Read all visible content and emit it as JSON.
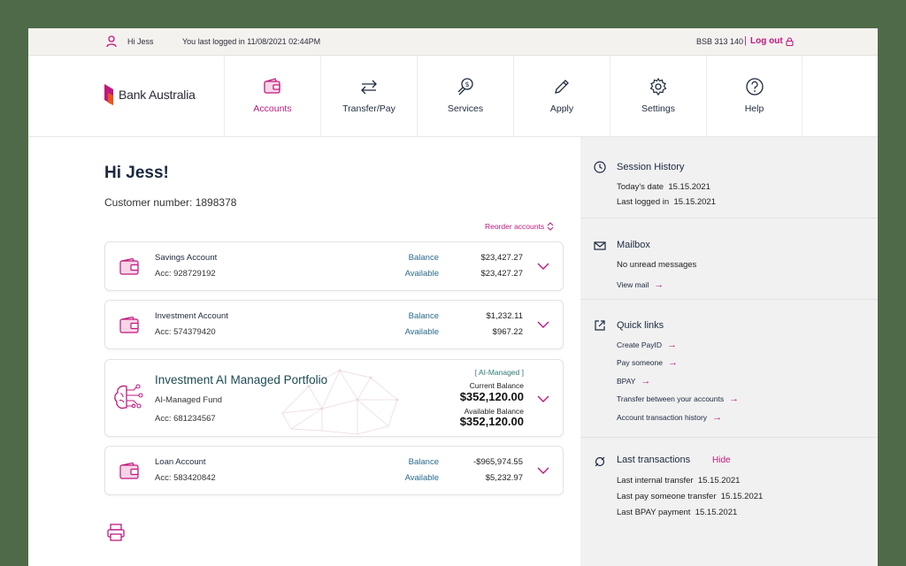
{
  "topbar": {
    "greeting": "Hi Jess",
    "last_login": "You last logged in 11/08/2021 02:44PM",
    "bsb": "BSB 313 140",
    "separator": "|",
    "logout": "Log out"
  },
  "brand": {
    "name": "Bank Australia",
    "accent": "#c0187d"
  },
  "nav": [
    {
      "label": "Accounts",
      "icon": "wallet-icon",
      "active": true
    },
    {
      "label": "Transfer/Pay",
      "icon": "transfer-icon"
    },
    {
      "label": "Services",
      "icon": "services-icon"
    },
    {
      "label": "Apply",
      "icon": "pencil-icon"
    },
    {
      "label": "Settings",
      "icon": "gear-icon"
    },
    {
      "label": "Help",
      "icon": "help-icon"
    }
  ],
  "main": {
    "title": "Hi Jess!",
    "customer_number": "Customer number: 1898378",
    "reorder": "Reorder accounts"
  },
  "accounts": [
    {
      "name": "Savings Account",
      "acc": "Acc: 928729192",
      "balance_label": "Balance",
      "balance": "$23,427.27",
      "available_label": "Available",
      "available": "$23,427.27"
    },
    {
      "name": "Investment Account",
      "acc": "Acc: 574379420",
      "balance_label": "Balance",
      "balance": "$1,232.11",
      "available_label": "Available",
      "available": "$967.22"
    },
    {
      "name": "Loan Account",
      "acc": "Acc: 583420842",
      "balance_label": "Balance",
      "balance": "-$965,974.55",
      "available_label": "Available",
      "available": "$5,232.97"
    }
  ],
  "ai_portfolio": {
    "name": "Investment AI Managed Portfolio",
    "fund_type": "AI-Managed Fund",
    "acc": "Acc: 681234567",
    "tag": "[ AI-Managed ]",
    "current_label": "Current Balance",
    "current": "$352,120.00",
    "available_label": "Available Balance",
    "available": "$352,120.00"
  },
  "sidebar": {
    "session": {
      "title": "Session History",
      "today_label": "Today's date",
      "today": "15.15.2021",
      "last_label": "Last logged in",
      "last": "15.15.2021"
    },
    "mailbox": {
      "title": "Mailbox",
      "status": "No unread messages",
      "view": "View mail"
    },
    "quick_links": {
      "title": "Quick links",
      "links": [
        "Create PayID",
        "Pay someone",
        "BPAY",
        "Transfer between your accounts",
        "Account transaction history"
      ]
    },
    "last_transactions": {
      "title": "Last transactions",
      "hide": "Hide",
      "rows": [
        {
          "label": "Last internal transfer",
          "date": "15.15.2021"
        },
        {
          "label": "Last pay someone transfer",
          "date": "15.15.2021"
        },
        {
          "label": "Last BPAY payment",
          "date": "15.15.2021"
        }
      ]
    }
  }
}
